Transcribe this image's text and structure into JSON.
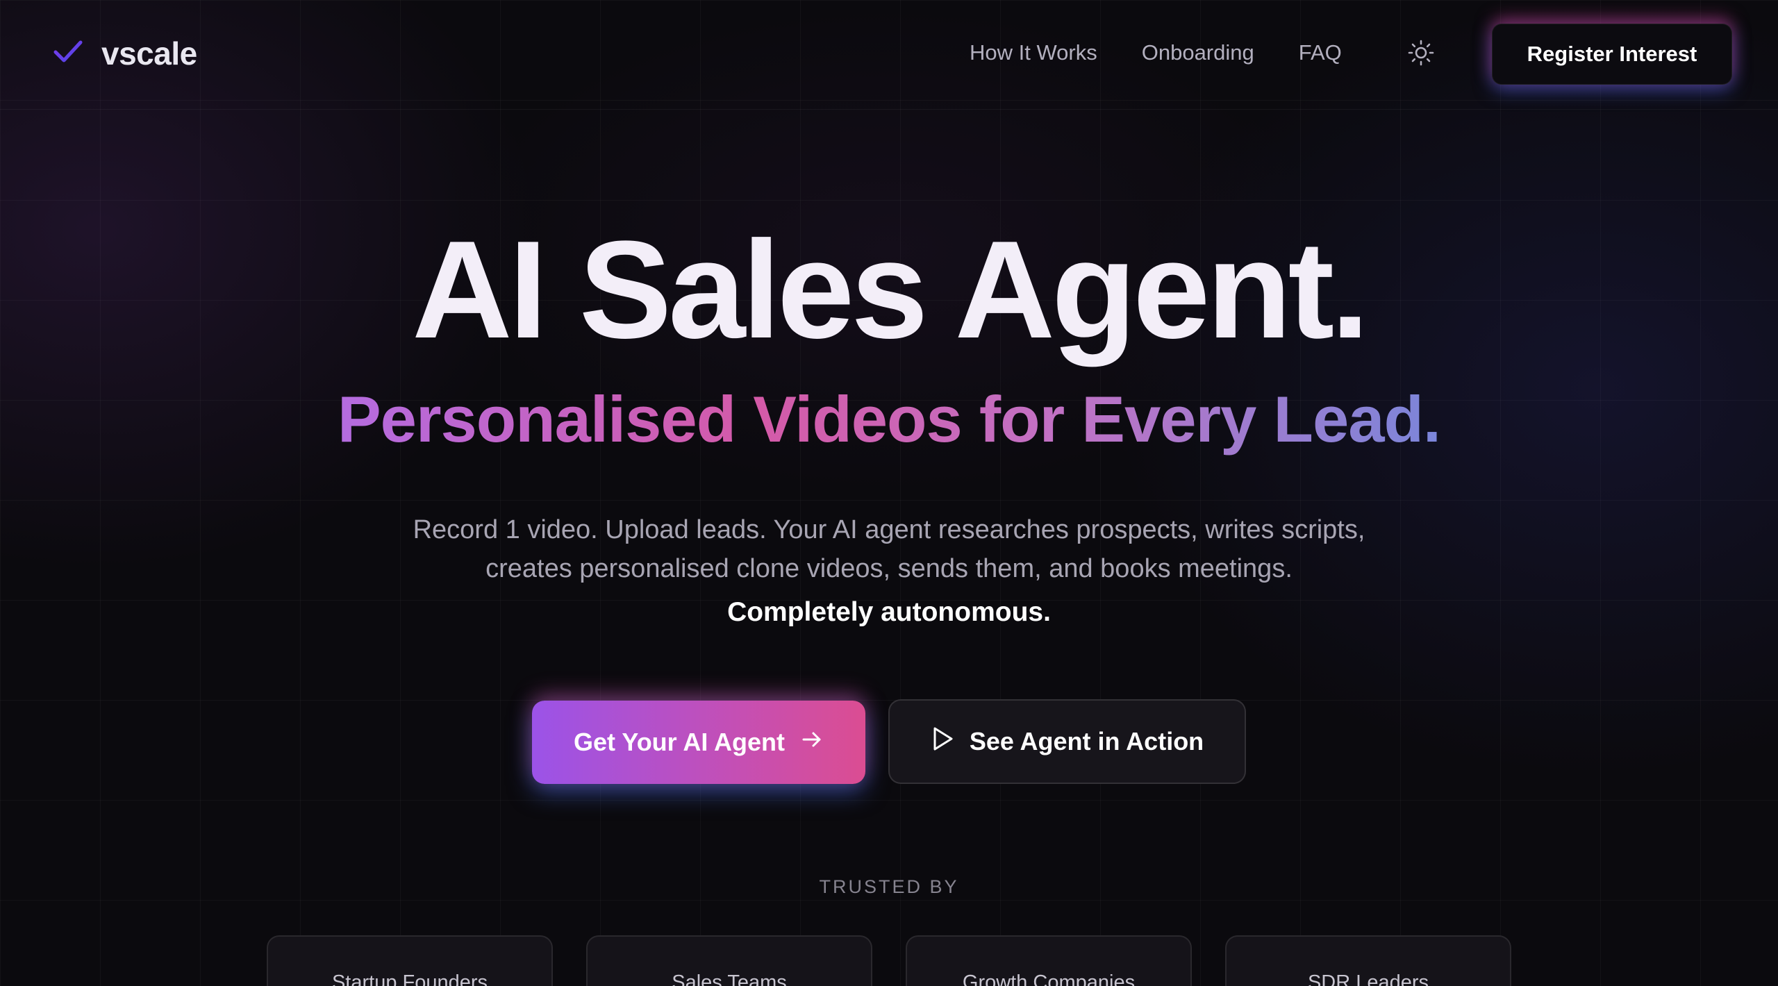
{
  "brand": {
    "name": "vscale",
    "icon": "check-icon",
    "accent": "#8b5cf6"
  },
  "nav": {
    "links": [
      "How It Works",
      "Onboarding",
      "FAQ"
    ],
    "theme_icon": "sun-icon",
    "register_label": "Register Interest"
  },
  "hero": {
    "title": "AI Sales Agent.",
    "subtitle": "Personalised Videos for Every Lead.",
    "description_line1": "Record 1 video. Upload leads. Your AI agent researches prospects, writes scripts,",
    "description_line2": "creates personalised clone videos, sends them, and books meetings.",
    "emphasis": "Completely autonomous.",
    "primary_cta": "Get Your AI Agent",
    "primary_cta_icon": "arrow-right-icon",
    "secondary_cta": "See Agent in Action",
    "secondary_cta_icon": "play-icon"
  },
  "trusted": {
    "label": "TRUSTED BY",
    "items": [
      "Startup Founders",
      "Sales Teams",
      "Growth Companies",
      "SDR Leaders"
    ]
  },
  "colors": {
    "background": "#0b0a0e",
    "gradient_start": "#9b53e8",
    "gradient_end": "#db4d92"
  }
}
